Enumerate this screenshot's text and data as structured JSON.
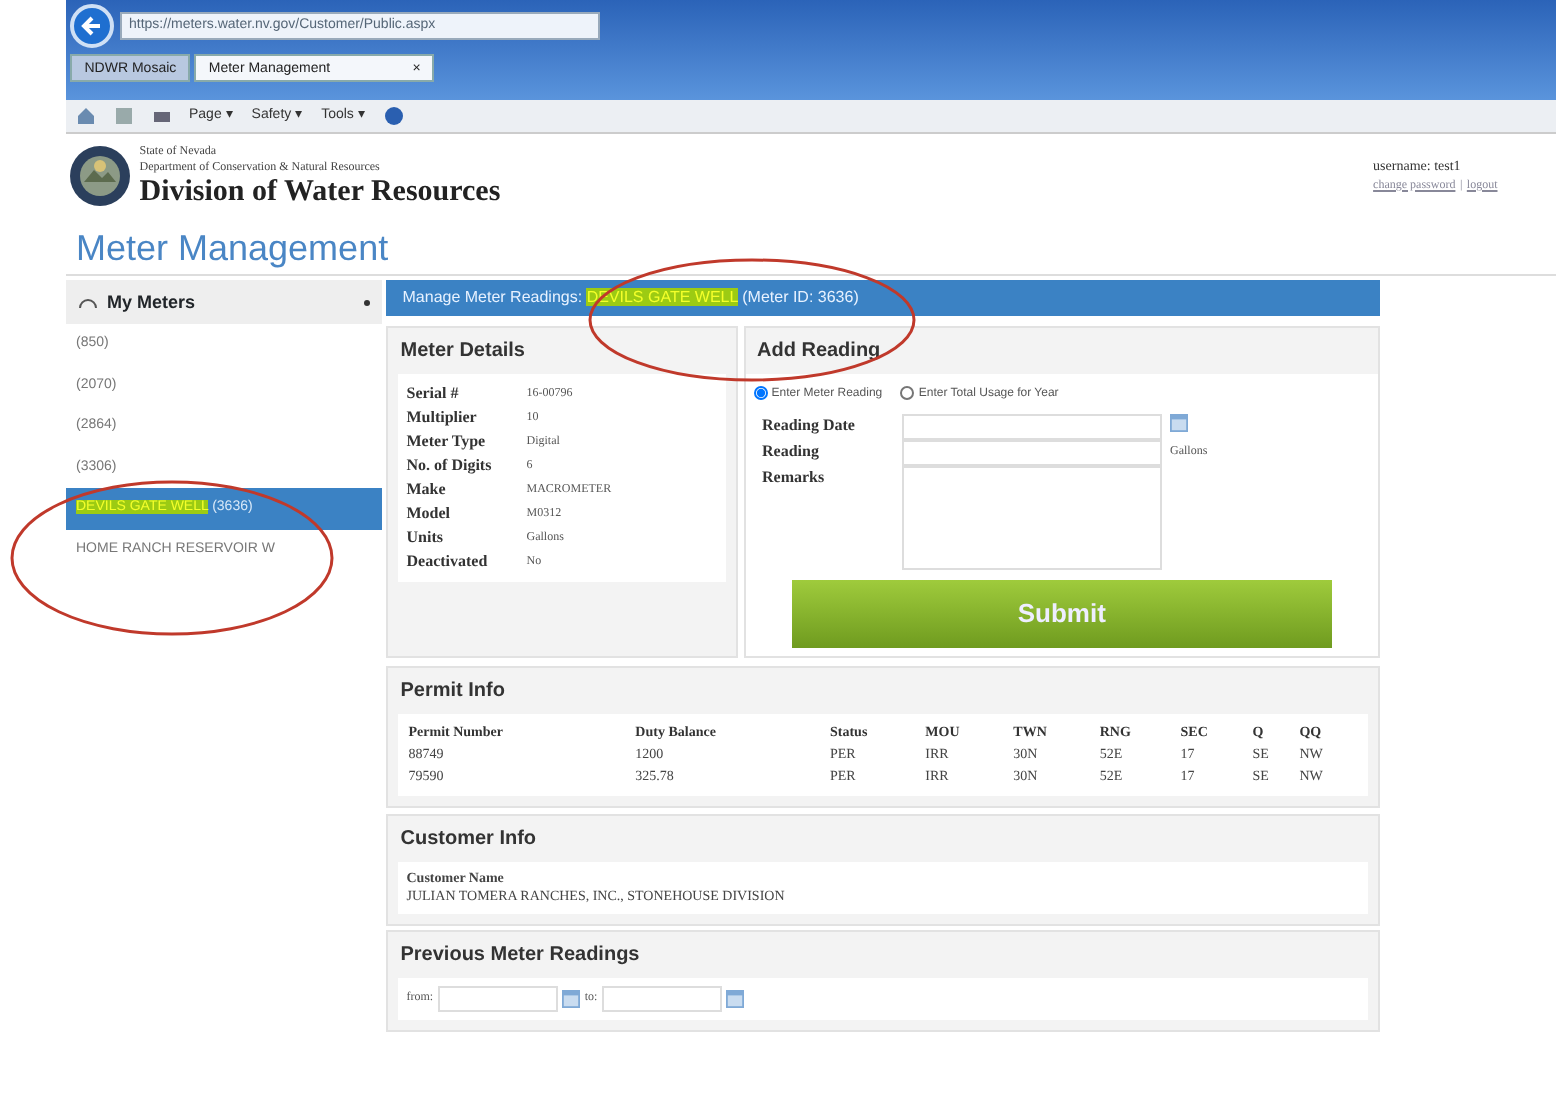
{
  "browser": {
    "address": "https://meters.water.nv.gov/Customer/Public.aspx",
    "tabs": [
      {
        "label": "NDWR Mosaic",
        "selected": false
      },
      {
        "label": "Meter Management",
        "selected": true,
        "close": "×"
      }
    ],
    "commands": [
      "Page ▾",
      "Safety ▾",
      "Tools ▾"
    ]
  },
  "header": {
    "state": "State of Nevada",
    "department": "Department of Conservation & Natural Resources",
    "division": "Division of Water Resources",
    "username": "username: test1",
    "links": [
      "change password",
      "logout"
    ],
    "separator": "|"
  },
  "page_title": "Meter Management",
  "sidebar": {
    "title": "My Meters",
    "items": [
      {
        "name": "(850)",
        "selected": false,
        "highlighted": false
      },
      {
        "name": "(2070)",
        "selected": false,
        "highlighted": false
      },
      {
        "name": "(2864)",
        "selected": false,
        "highlighted": false
      },
      {
        "name": "(3306)",
        "selected": false,
        "highlighted": false
      },
      {
        "name": "DEVILS GATE WELL",
        "id": "(3636)",
        "selected": true,
        "highlighted": true
      },
      {
        "name": "HOME RANCH RESERVOIR W",
        "selected": false,
        "highlighted": false
      }
    ]
  },
  "banner": {
    "prefix": "Manage Meter Readings:",
    "highlight": "DEVILS GATE WELL",
    "suffix": "(Meter ID: 3636)"
  },
  "meter_details": {
    "title": "Meter Details",
    "rows": [
      {
        "label": "Serial #",
        "value": "16-00796"
      },
      {
        "label": "Multiplier",
        "value": "10"
      },
      {
        "label": "Meter Type",
        "value": "Digital"
      },
      {
        "label": "No. of Digits",
        "value": "6"
      },
      {
        "label": "Make",
        "value": "MACROMETER"
      },
      {
        "label": "Model",
        "value": "M0312"
      },
      {
        "label": "Units",
        "value": "Gallons"
      },
      {
        "label": "Deactivated",
        "value": "No"
      }
    ]
  },
  "add_reading": {
    "title": "Add Reading",
    "options": [
      {
        "label": "Enter Meter Reading",
        "selected": true
      },
      {
        "label": "Enter Total Usage for Year",
        "selected": false
      }
    ],
    "fields": [
      {
        "label": "Reading Date",
        "kind": "date"
      },
      {
        "label": "Reading",
        "kind": "text",
        "unit": "Gallons"
      },
      {
        "label": "Remarks",
        "kind": "textarea"
      }
    ],
    "submit": "Submit"
  },
  "permit_info": {
    "title": "Permit Info",
    "columns": [
      "Permit Number",
      "Duty Balance",
      "Status",
      "MOU",
      "TWN",
      "RNG",
      "SEC",
      "Q",
      "QQ"
    ],
    "rows": [
      [
        "88749",
        "1200",
        "PER",
        "IRR",
        "30N",
        "52E",
        "17",
        "SE",
        "NW"
      ],
      [
        "79590",
        "325.78",
        "PER",
        "IRR",
        "30N",
        "52E",
        "17",
        "SE",
        "NW"
      ]
    ]
  },
  "customer_info": {
    "title": "Customer Info",
    "label": "Customer Name",
    "value": "JULIAN TOMERA RANCHES, INC., STONEHOUSE DIVISION"
  },
  "previous_readings": {
    "title": "Previous Meter Readings",
    "from": "from:",
    "to": "to:"
  }
}
